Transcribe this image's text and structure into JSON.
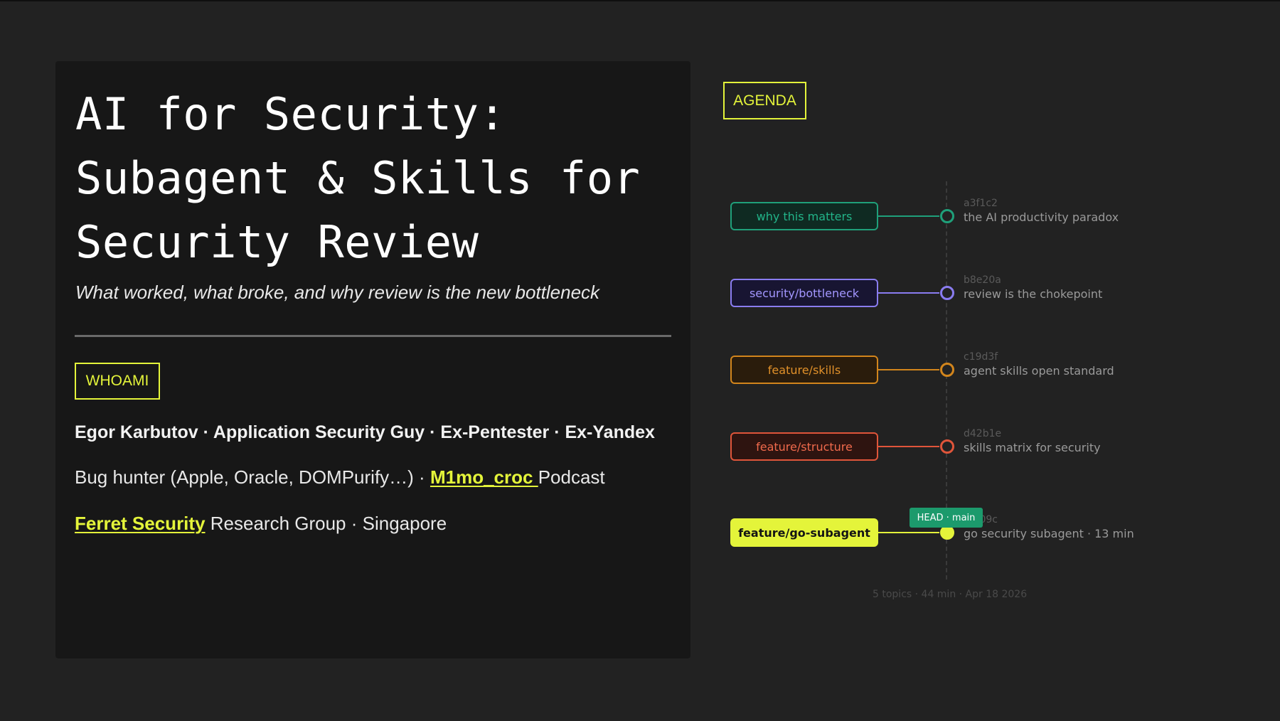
{
  "slide": {
    "title_lines": [
      "AI for Security:",
      "Subagent & Skills for",
      "Security Review"
    ],
    "subtitle": "What worked, what broke, and why review is the new bottleneck",
    "whoami_label": "WHOAMI",
    "name_line": "Egor Karbutov · Application Security Guy · Ex-Pentester · Ex-Yandex",
    "bio_line1_prefix": "Bug hunter (Apple, Oracle, DOMPurify…) · ",
    "bio_line1_link": "M1mo_croc ",
    "bio_line1_suffix": "Podcast",
    "bio_line2_link": "Ferret Security",
    "bio_line2_suffix": " Research Group  · Singapore"
  },
  "agenda": {
    "label": "AGENDA",
    "branches": [
      {
        "branch": "why this matters",
        "hash": "a3f1c2",
        "message": "the AI productivity paradox",
        "color": "#1fa07a",
        "fill": "#0f2a22",
        "text_color": "#22b489"
      },
      {
        "branch": "security/bottleneck",
        "hash": "b8e20a",
        "message": "review is the chokepoint",
        "color": "#8a7cf0",
        "fill": "#181532",
        "text_color": "#a397ff"
      },
      {
        "branch": "feature/skills",
        "hash": "c19d3f",
        "message": "agent skills open standard",
        "color": "#d2851c",
        "fill": "#2a1c0c",
        "text_color": "#e0902a"
      },
      {
        "branch": "feature/structure",
        "hash": "d42b1e",
        "message": "skills matrix for security",
        "color": "#e0553a",
        "fill": "#2e1410",
        "text_color": "#f06a4c"
      },
      {
        "branch": "feature/go-subagent",
        "hash": "e7f09c",
        "message": "go security subagent · 13 min",
        "color": "#e4f43a",
        "fill": "#e4f43a",
        "text_color": "#141414"
      }
    ],
    "head_tag": "HEAD · main",
    "footer": "5 topics · 44 min · Apr 18 2026"
  }
}
